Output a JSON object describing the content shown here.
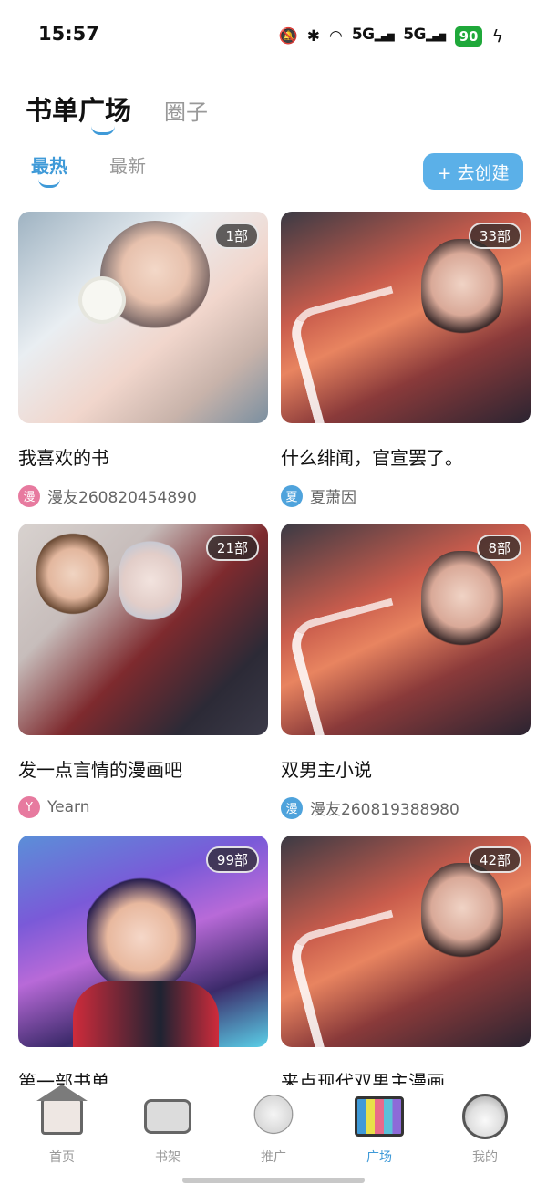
{
  "status_bar": {
    "time": "15:57",
    "network1": "5G",
    "network2": "5G",
    "battery": "90"
  },
  "header": {
    "tab_active": "书单广场",
    "tab_inactive": "圈子"
  },
  "subtabs": {
    "active": "最热",
    "inactive": "最新"
  },
  "create_button": "+ 去创建",
  "cards": [
    {
      "badge": "1部",
      "title": "我喜欢的书",
      "avatar": "漫",
      "author": "漫友260820454890"
    },
    {
      "badge": "33部",
      "title": "什么绯闻，官宣罢了。",
      "avatar": "夏",
      "author": "夏萧因"
    },
    {
      "badge": "21部",
      "title": "发一点言情的漫画吧",
      "avatar": "Y",
      "author": "Yearn"
    },
    {
      "badge": "8部",
      "title": "双男主小说",
      "avatar": "漫",
      "author": "漫友260819388980"
    },
    {
      "badge": "99部",
      "title": "第一部书单",
      "avatar": "",
      "author": ""
    },
    {
      "badge": "42部",
      "title": "来点现代双男主漫画",
      "avatar": "",
      "author": ""
    }
  ],
  "bottom_nav": {
    "home": "首页",
    "shelf": "书架",
    "promo": "推广",
    "plaza": "广场",
    "me": "我的"
  },
  "colors": {
    "accent": "#3f9ad8",
    "button": "#5bb0e8"
  }
}
